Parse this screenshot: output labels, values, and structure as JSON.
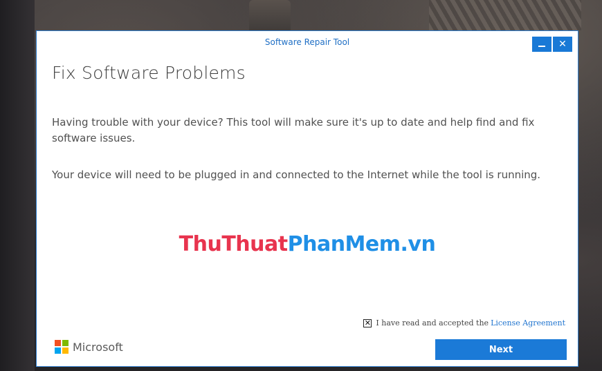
{
  "window": {
    "title": "Software Repair Tool",
    "minimize_glyph": "minimize-icon",
    "close_label": "✕"
  },
  "content": {
    "heading": "Fix Software Problems",
    "paragraph_1": "Having trouble with your device? This tool will make sure it's up to date and help find and fix software issues.",
    "paragraph_2": "Your device will need to be plugged in and connected to the Internet while the tool is running."
  },
  "watermark": {
    "part_red": "ThuThuat",
    "part_blue": "PhanMem.vn"
  },
  "agreement": {
    "checked": true,
    "check_mark": "✕",
    "text": "I have read and accepted the",
    "link_text": "License Agreement"
  },
  "footer": {
    "brand_name": "Microsoft",
    "next_label": "Next"
  },
  "colors": {
    "accent": "#1b7ad7",
    "title_text": "#1f6fc5",
    "logo_red": "#f25022",
    "logo_green": "#7fba00",
    "logo_blue": "#00a4ef",
    "logo_yellow": "#ffb900",
    "watermark_red": "#e8344e",
    "watermark_blue": "#1f8fe6"
  }
}
